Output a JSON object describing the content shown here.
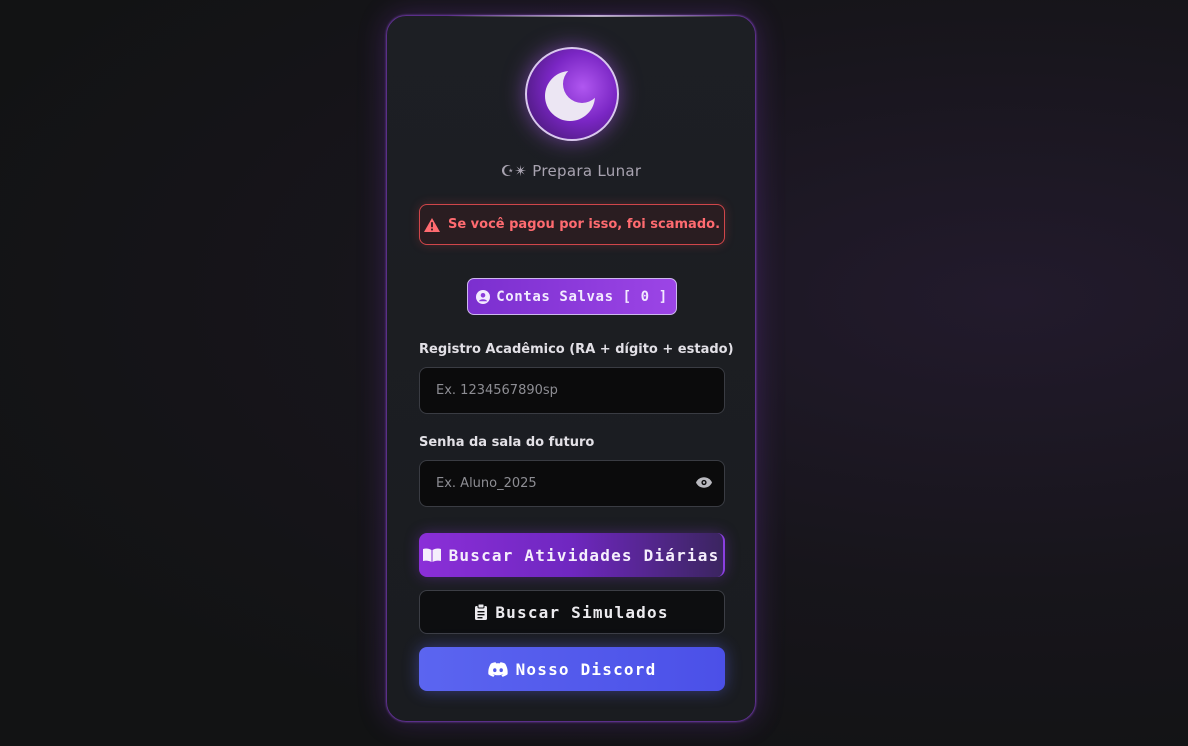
{
  "brand": {
    "name": "☪✴ Prepara Lunar"
  },
  "warning": {
    "icon": "warning-triangle-icon",
    "text": "Se você pagou por isso, foi scamado."
  },
  "saved_accounts": {
    "icon": "user-circle-icon",
    "label": "Contas Salvas [ 0 ]"
  },
  "ra_field": {
    "label": "Registro Acadêmico (RA + dígito + estado)",
    "placeholder": "Ex. 1234567890sp",
    "value": ""
  },
  "password_field": {
    "label": "Senha da sala do futuro",
    "placeholder": "Ex. Aluno_2025",
    "value": "",
    "toggle_icon": "eye-icon"
  },
  "buttons": {
    "atividades": {
      "icon": "book-icon",
      "label": "Buscar Atividades Diárias"
    },
    "simulados": {
      "icon": "clipboard-icon",
      "label": "Buscar Simulados"
    },
    "discord": {
      "icon": "discord-icon",
      "label": "Nosso Discord"
    }
  },
  "colors": {
    "accent": "#8b2fd8",
    "warning": "#ff6b70",
    "discord": "#5865f2",
    "card_border": "#5b2f8a"
  }
}
